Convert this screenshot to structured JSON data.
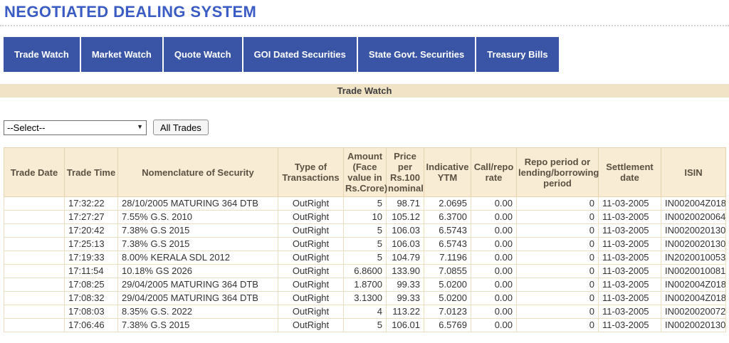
{
  "header": {
    "title": "NEGOTIATED DEALING SYSTEM",
    "title_color": "#3b5cc4"
  },
  "nav": {
    "background_color": "#3a55a6",
    "items": [
      {
        "label": "Trade Watch"
      },
      {
        "label": "Market Watch"
      },
      {
        "label": "Quote Watch"
      },
      {
        "label": "GOI Dated Securities"
      },
      {
        "label": "State Govt. Securities"
      },
      {
        "label": "Treasury Bills"
      }
    ]
  },
  "section": {
    "title": "Trade Watch",
    "background_color": "#f0e3c6"
  },
  "controls": {
    "select_value": "--Select--",
    "all_trades_label": "All Trades",
    "dropdown_icon": "▼"
  },
  "table": {
    "header_background": "#f8ecd4",
    "border_color": "#ecdfc0",
    "columns": [
      "Trade Date",
      "Trade Time",
      "Nomenclature of Security",
      "Type of Transactions",
      "Amount (Face value in Rs.Crore)",
      "Price per Rs.100 nominal",
      "Indicative YTM",
      "Call/repo rate",
      "Repo period or lending/borrowing period",
      "Settlement date",
      "ISIN"
    ],
    "rows": [
      [
        "",
        "17:32:22",
        "28/10/2005 MATURING 364 DTB",
        "OutRight",
        "5",
        "98.71",
        "2.0695",
        "0.00",
        "0",
        "11-03-2005",
        "IN002004Z018"
      ],
      [
        "",
        "17:27:27",
        "7.55% G.S. 2010",
        "OutRight",
        "10",
        "105.12",
        "6.3700",
        "0.00",
        "0",
        "11-03-2005",
        "IN0020020064"
      ],
      [
        "",
        "17:20:42",
        "7.38% G.S 2015",
        "OutRight",
        "5",
        "106.03",
        "6.5743",
        "0.00",
        "0",
        "11-03-2005",
        "IN0020020130"
      ],
      [
        "",
        "17:25:13",
        "7.38% G.S 2015",
        "OutRight",
        "5",
        "106.03",
        "6.5743",
        "0.00",
        "0",
        "11-03-2005",
        "IN0020020130"
      ],
      [
        "",
        "17:19:33",
        "8.00% KERALA SDL 2012",
        "OutRight",
        "5",
        "104.79",
        "7.1196",
        "0.00",
        "0",
        "11-03-2005",
        "IN2020010053"
      ],
      [
        "",
        "17:11:54",
        "10.18% GS 2026",
        "OutRight",
        "6.8600",
        "133.90",
        "7.0855",
        "0.00",
        "0",
        "11-03-2005",
        "IN0020010081"
      ],
      [
        "",
        "17:08:25",
        "29/04/2005 MATURING 364 DTB",
        "OutRight",
        "1.8700",
        "99.33",
        "5.0200",
        "0.00",
        "0",
        "11-03-2005",
        "IN002004Z018"
      ],
      [
        "",
        "17:08:32",
        "29/04/2005 MATURING 364 DTB",
        "OutRight",
        "3.1300",
        "99.33",
        "5.0200",
        "0.00",
        "0",
        "11-03-2005",
        "IN002004Z018"
      ],
      [
        "",
        "17:08:03",
        "8.35% G.S. 2022",
        "OutRight",
        "4",
        "113.22",
        "7.0123",
        "0.00",
        "0",
        "11-03-2005",
        "IN0020020072"
      ],
      [
        "",
        "17:06:46",
        "7.38% G.S 2015",
        "OutRight",
        "5",
        "106.01",
        "6.5769",
        "0.00",
        "0",
        "11-03-2005",
        "IN0020020130"
      ]
    ]
  }
}
